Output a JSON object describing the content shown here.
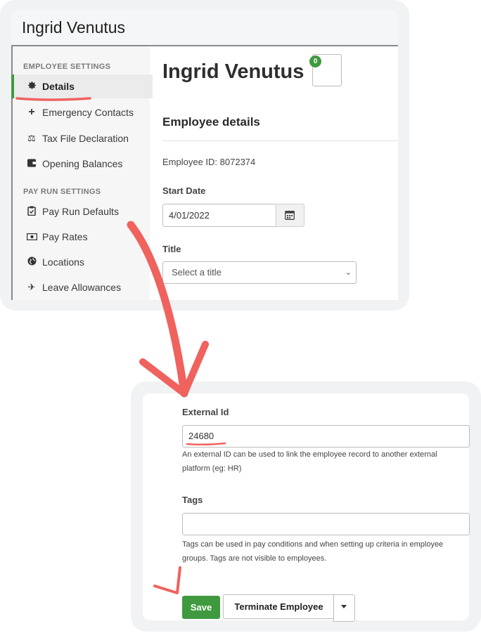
{
  "window": {
    "title": "Ingrid Venutus"
  },
  "sidebar": {
    "employee_settings_label": "EMPLOYEE SETTINGS",
    "pay_run_settings_label": "PAY RUN SETTINGS",
    "items": [
      {
        "label": "Details",
        "icon": "gear-icon",
        "active": true
      },
      {
        "label": "Emergency Contacts",
        "icon": "plus-icon"
      },
      {
        "label": "Tax File Declaration",
        "icon": "scales-icon"
      },
      {
        "label": "Opening Balances",
        "icon": "wallet-icon"
      },
      {
        "label": "Pay Run Defaults",
        "icon": "clipboard-icon"
      },
      {
        "label": "Pay Rates",
        "icon": "money-icon"
      },
      {
        "label": "Locations",
        "icon": "globe-icon"
      },
      {
        "label": "Leave Allowances",
        "icon": "plane-icon"
      }
    ]
  },
  "main": {
    "employee_name": "Ingrid Venutus",
    "badge_count": "0",
    "section_title": "Employee details",
    "employee_id": "Employee ID: 8072374",
    "start_date_label": "Start Date",
    "start_date_value": "4/01/2022",
    "title_label": "Title",
    "title_placeholder": "Select a title"
  },
  "bottom": {
    "external_id_label": "External Id",
    "external_id_value": "24680",
    "external_id_help": "An external ID can be used to link the employee record to another external platform (eg: HR)",
    "tags_label": "Tags",
    "tags_value": "",
    "tags_help": "Tags can be used in pay conditions and when setting up criteria in employee groups. Tags are not visible to employees.",
    "save_label": "Save",
    "terminate_label": "Terminate Employee"
  },
  "colors": {
    "accent_green": "#3f9a3f",
    "annotation_red": "#f0625e"
  }
}
